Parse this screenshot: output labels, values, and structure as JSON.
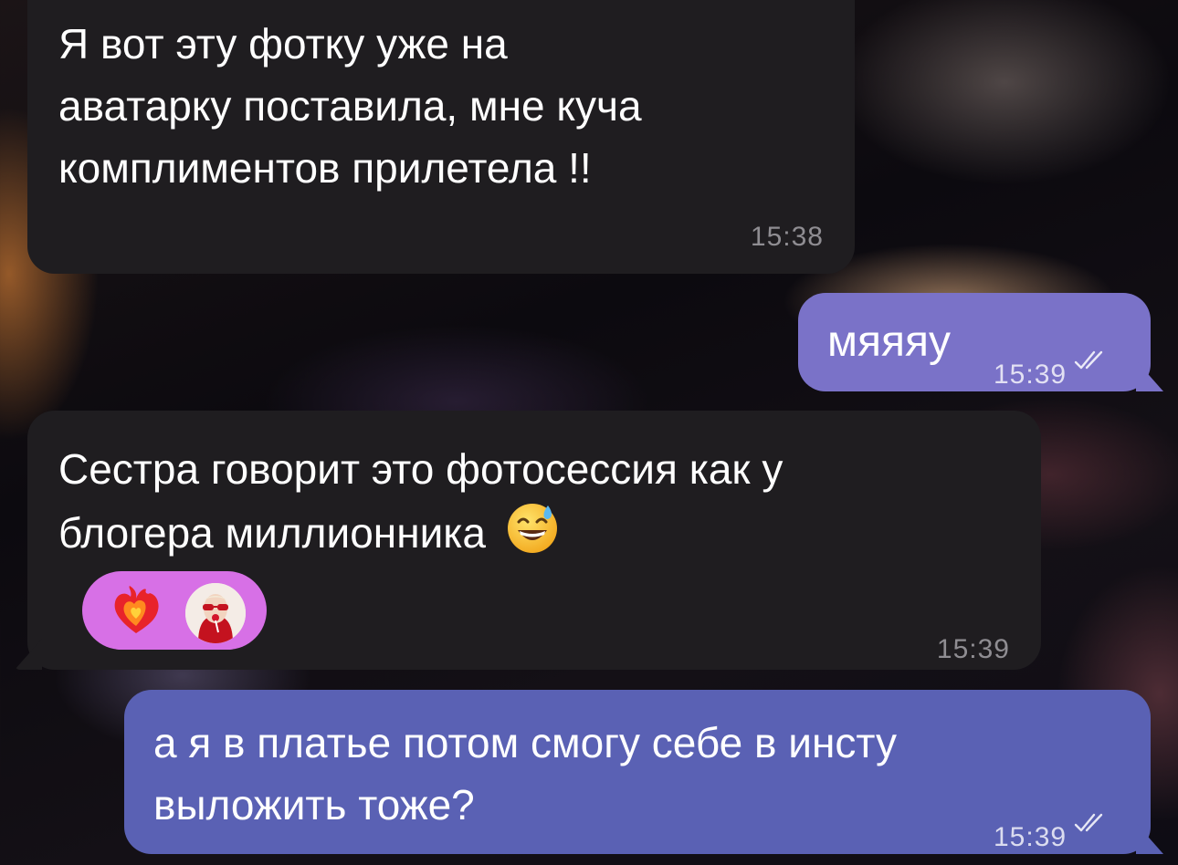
{
  "messages": [
    {
      "direction": "incoming",
      "text_lines": [
        "Я вот эту фотку уже на",
        "аватарку поставила, мне куча",
        "комплиментов прилетела !!"
      ],
      "time": "15:38"
    },
    {
      "direction": "outgoing",
      "text": "мяяяу",
      "time": "15:39",
      "status_icon": "double-check-icon"
    },
    {
      "direction": "incoming",
      "text_lines": [
        "Сестра говорит это фотосессия как у",
        "блогера миллионника"
      ],
      "inline_emoji": "grinning-face-with-sweat-icon",
      "time": "15:39",
      "reactions": [
        "heart-on-fire-icon",
        "reactor-avatar"
      ]
    },
    {
      "direction": "outgoing",
      "text_lines": [
        "а я в платье потом смогу себе в инсту",
        "выложить тоже?"
      ],
      "time": "15:39",
      "status_icon": "double-check-icon"
    }
  ],
  "colors": {
    "incoming_bubble": "#1f1d20",
    "outgoing_bubble_1": "#7a72c8",
    "outgoing_bubble_2": "#5a61b4",
    "reaction_pill": "#d770e6"
  }
}
